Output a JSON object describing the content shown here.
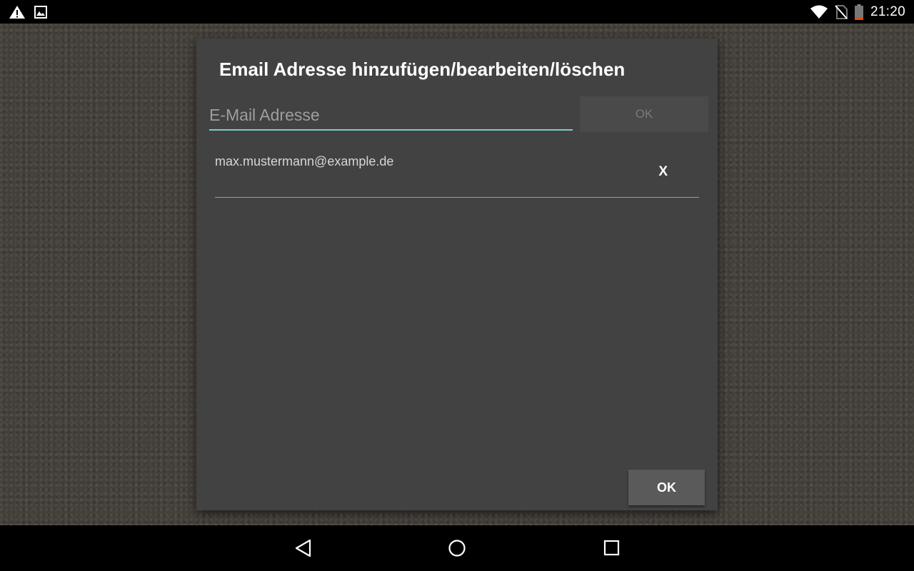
{
  "status_bar": {
    "left_icons": [
      "warning-icon",
      "image-icon"
    ],
    "right_icons": [
      "wifi-icon",
      "no-sim-icon",
      "battery-icon"
    ],
    "time": "21:20"
  },
  "dialog": {
    "title": "Email Adresse hinzufügen/bearbeiten/löschen",
    "email_input": {
      "placeholder": "E-Mail Adresse",
      "value": ""
    },
    "add_button_label": "OK",
    "emails": [
      {
        "address": "max.mustermann@example.de",
        "delete_label": "X"
      }
    ],
    "confirm_button_label": "OK"
  },
  "nav_bar": {
    "buttons": [
      "back-icon",
      "home-icon",
      "recents-icon"
    ]
  },
  "colors": {
    "dialog_background": "#424242",
    "input_underline": "#80cbc4",
    "wallpaper": "#433f39"
  }
}
